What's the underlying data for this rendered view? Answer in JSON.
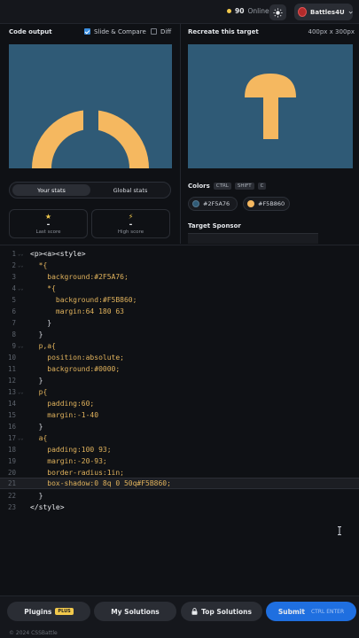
{
  "topbar": {
    "online_count": "90",
    "online_label": "Online",
    "username": "Battles4U"
  },
  "left_panel": {
    "title": "Code output",
    "slide_compare_label": "Slide & Compare",
    "slide_compare_checked": true,
    "diff_label": "Diff",
    "diff_checked": false
  },
  "right_panel": {
    "title": "Recreate this target",
    "dimensions": "400px x 300px"
  },
  "stats": {
    "tabs": [
      "Your stats",
      "Global stats"
    ],
    "active_tab": "Your stats",
    "last_score": {
      "value": "-",
      "label": "Last score",
      "icon": "star-icon"
    },
    "high_score": {
      "value": "-",
      "label": "High score",
      "icon": "bolt-icon"
    }
  },
  "colors": {
    "title": "Colors",
    "shortcut": [
      "CTRL",
      "SHIFT",
      "C"
    ],
    "swatches": [
      {
        "hex": "#2F5A76",
        "label": "#2F5A76"
      },
      {
        "hex": "#F5B860",
        "label": "#F5B860"
      }
    ]
  },
  "sponsor": {
    "title": "Target Sponsor"
  },
  "editor": {
    "lines": [
      "<p><a><style>",
      "  *{",
      "    background:#2F5A76;",
      "    *{",
      "      background:#F5B860;",
      "      margin:64 180 63",
      "    }",
      "  }",
      "  p,a{",
      "    position:absolute;",
      "    background:#0000;",
      "  }",
      "  p{",
      "    padding:60;",
      "    margin:-1-40",
      "  }",
      "  a{",
      "    padding:100 93;",
      "    margin:-20-93;",
      "    border-radius:1in;",
      "    box-shadow:0 8q 0 50q#F5B860;",
      "  }",
      "</style>"
    ],
    "active_line": 21
  },
  "bottom": {
    "plugins_label": "Plugins",
    "plus_badge": "PLUS",
    "my_solutions_label": "My Solutions",
    "top_solutions_label": "Top Solutions",
    "submit_label": "Submit",
    "submit_shortcut": "CTRL ENTER",
    "footer": "© 2024 CSSBattle"
  },
  "palette": {
    "background": "#2F5A76",
    "shape": "#F5B860",
    "accent": "#1f6fe0"
  }
}
